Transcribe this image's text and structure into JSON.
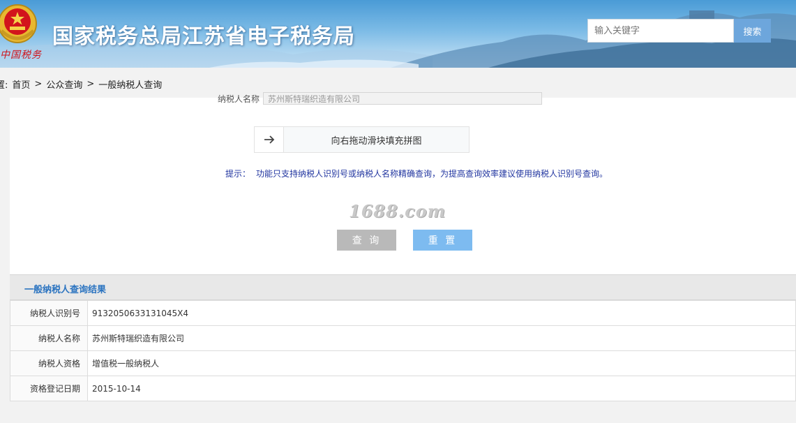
{
  "header": {
    "emblem_script": "中国税务",
    "site_title": "国家税务总局江苏省电子税务局",
    "search": {
      "placeholder": "输入关键字",
      "button_label": "搜索"
    }
  },
  "breadcrumb": {
    "prefix": "置:",
    "items": [
      "首页",
      ">",
      "公众查询",
      ">",
      "一般纳税人查询"
    ]
  },
  "form": {
    "cut_off_label": "纳税人名称",
    "cut_off_value": "苏州斯特瑞织造有限公司",
    "slider_text": "向右拖动滑块填充拼图",
    "tip_label": "提示：",
    "tip_text": "功能只支持纳税人识别号或纳税人名称精确查询，为提高查询效率建议使用纳税人识别号查询。",
    "watermark": "1688.com",
    "query_button": "查 询",
    "reset_button": "重 置"
  },
  "result": {
    "title": "一般纳税人查询结果",
    "rows": [
      {
        "label": "纳税人识别号",
        "value": "9132050633131045X4"
      },
      {
        "label": "纳税人名称",
        "value": "苏州斯特瑞织造有限公司"
      },
      {
        "label": "纳税人资格",
        "value": "增值税一般纳税人"
      },
      {
        "label": "资格登记日期",
        "value": "2015-10-14"
      }
    ]
  },
  "colors": {
    "accent": "#2a73c0",
    "tip": "#2236a0",
    "query_button": "#b9b9b9",
    "reset_button": "#7dbbf0",
    "search_button": "#6da6dc"
  }
}
